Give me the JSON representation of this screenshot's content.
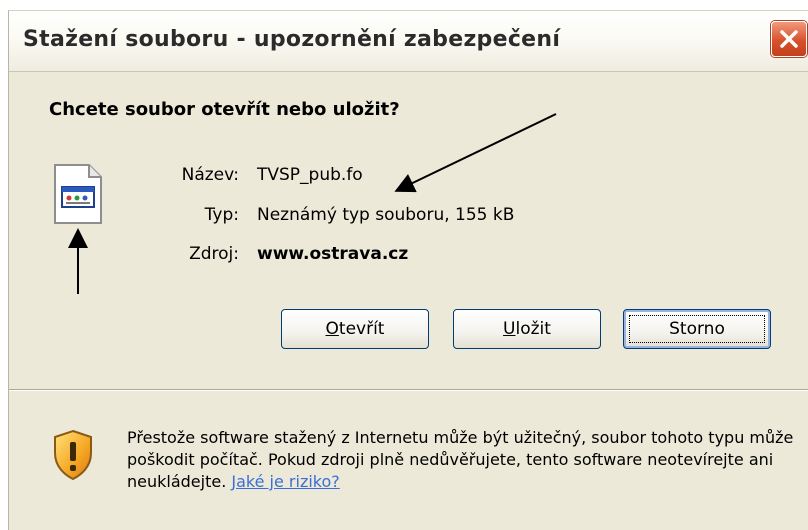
{
  "window": {
    "title": "Stažení souboru - upozornění zabezpečení",
    "close_icon": "close-icon"
  },
  "dialog": {
    "question": "Chcete soubor otevřít nebo uložit?",
    "file_icon": "file-icon",
    "fields": [
      {
        "label": "Název:",
        "value": "TVSP_pub.fo"
      },
      {
        "label": "Typ:",
        "value": "Neznámý typ souboru, 155 kB"
      },
      {
        "label": "Zdroj:",
        "value": "www.ostrava.cz"
      }
    ]
  },
  "buttons": {
    "open": {
      "accel": "O",
      "rest": "tevřít"
    },
    "save": {
      "accel": "U",
      "rest": "ložit"
    },
    "cancel": {
      "label": "Storno"
    }
  },
  "warning": {
    "icon": "shield-warning-icon",
    "text": "Přestože software stažený z Internetu může být užitečný, soubor tohoto typu může poškodit počítač. Pokud zdroji plně nedůvěřujete, tento software neotevírejte ani neukládejte.",
    "link": "Jaké je riziko?"
  },
  "colors": {
    "dialog_bg": "#ece9d8",
    "close_button": "#d8512c",
    "link": "#3a6fd8"
  }
}
